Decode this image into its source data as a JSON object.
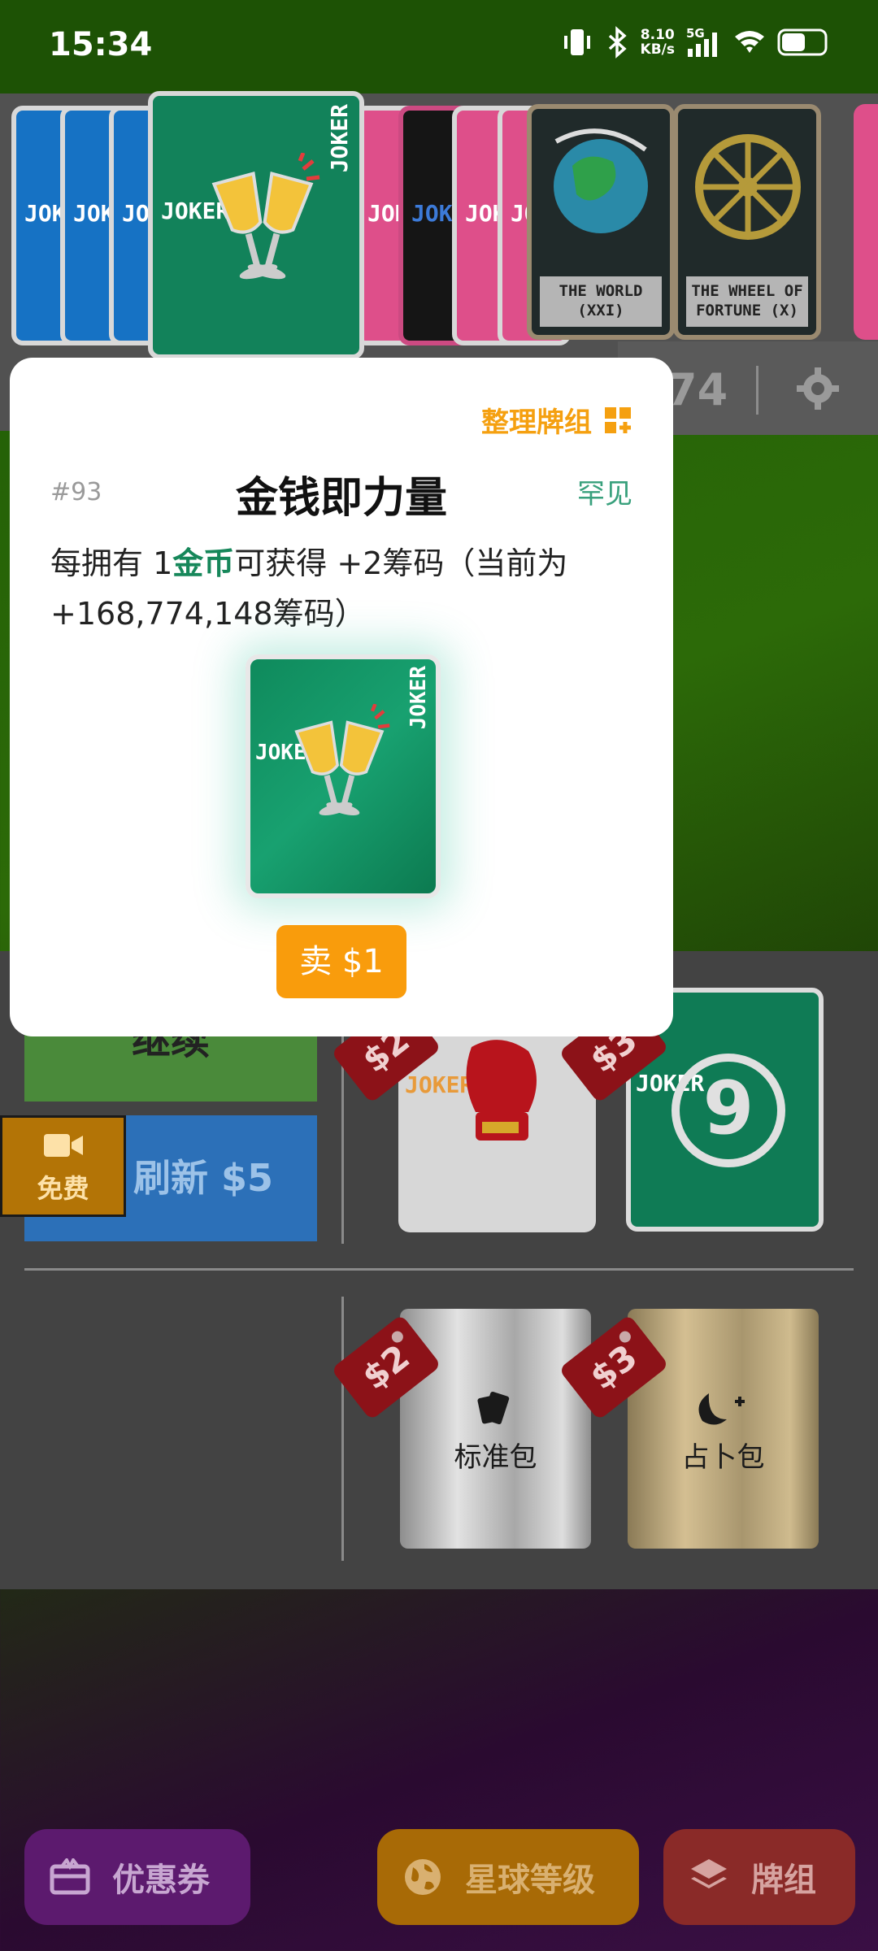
{
  "status_bar": {
    "time": "15:34",
    "net_speed_value": "8.10",
    "net_speed_unit": "KB/s",
    "network": "5G"
  },
  "strip": {
    "joker_text": "JOKER",
    "tarot": [
      {
        "name_line1": "THE WORLD",
        "name_line2": "(XXI)"
      },
      {
        "name_line1": "THE WHEEL OF",
        "name_line2": "FORTUNE (X)"
      }
    ],
    "hud_partial_number": "74"
  },
  "popup": {
    "organize_label": "整理牌组",
    "id": "#93",
    "title": "金钱即力量",
    "rarity": "罕见",
    "desc_prefix": "每拥有 1",
    "desc_highlight": "金币",
    "desc_suffix": "可获得 +2筹码（当前为 +168,774,148筹码）",
    "card_text": "JOKER",
    "sell_label": "卖 $1"
  },
  "shop": {
    "continue_label": "继续",
    "refresh_label": "刷新 $5",
    "free_label": "免费",
    "cards": [
      {
        "price": "$2",
        "text": "JOKER"
      },
      {
        "price": "$3",
        "text": "JOKER"
      }
    ],
    "packs": [
      {
        "price": "$2",
        "label": "标准包"
      },
      {
        "price": "$3",
        "label": "占卜包"
      }
    ]
  },
  "bottom_bar": {
    "coupon_label": "优惠券",
    "planet_label": "星球等级",
    "deck_label": "牌组"
  },
  "colors": {
    "accent_orange": "#f99c0c",
    "rare_green": "#38a07c",
    "tag_red": "#8c1218"
  }
}
